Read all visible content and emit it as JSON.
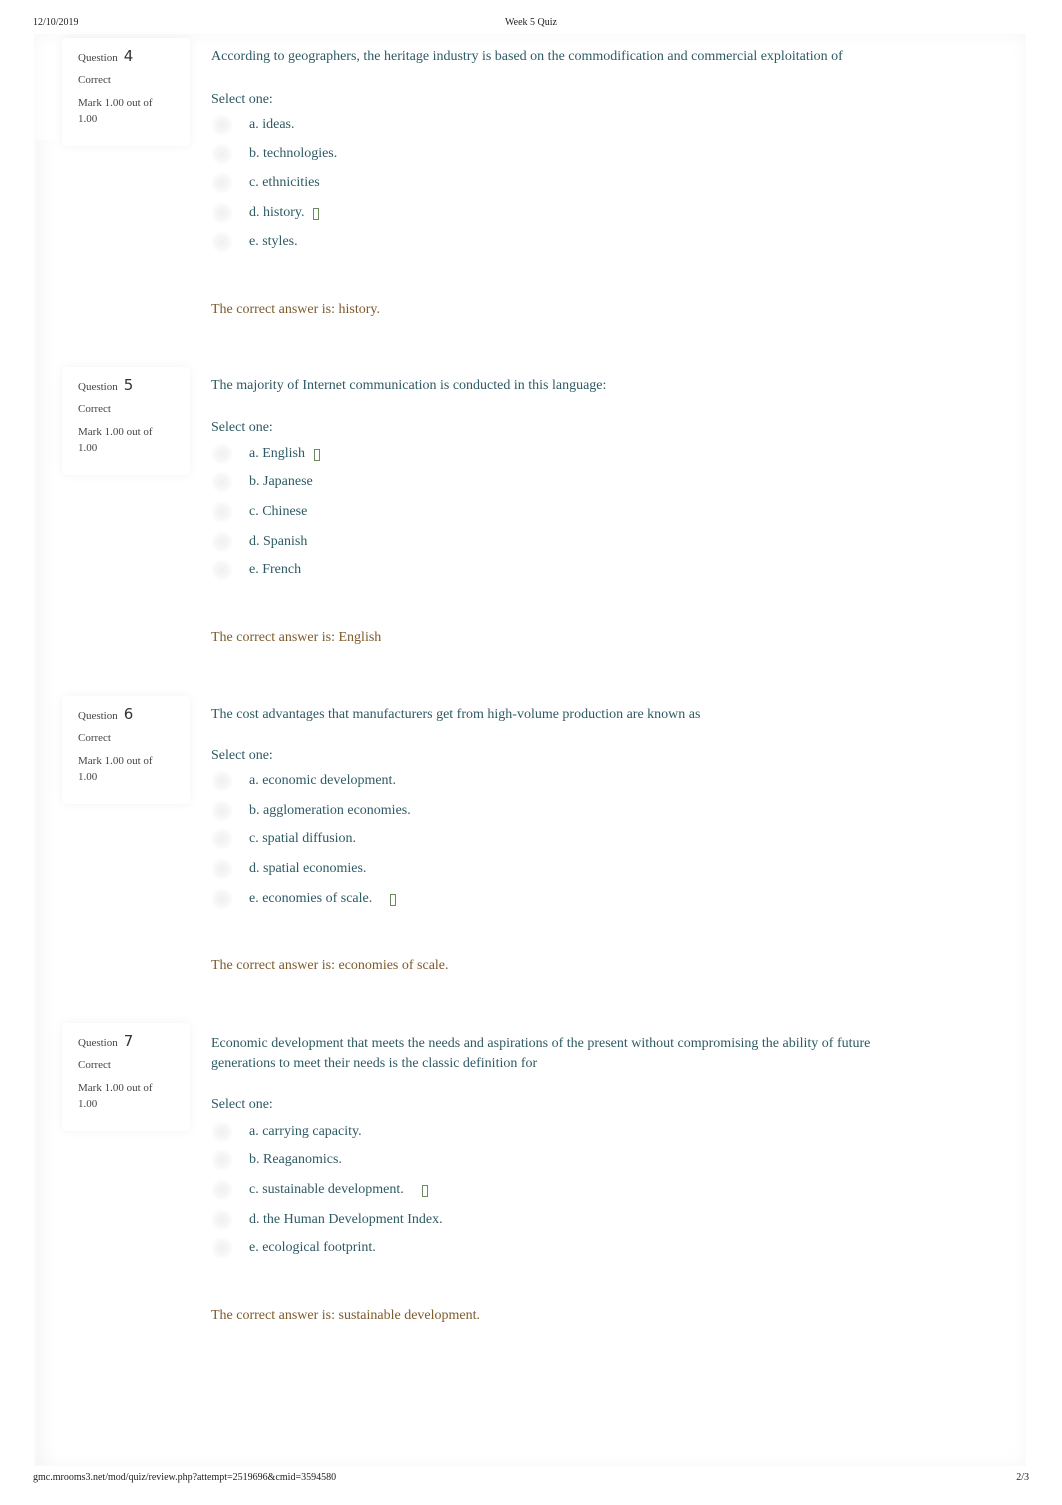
{
  "header": {
    "date": "12/10/2019",
    "title": "Week 5 Quiz"
  },
  "footer": {
    "url": "gmc.mrooms3.net/mod/quiz/review.php?attempt=2519696&cmid=3594580",
    "page": "2/3"
  },
  "labels": {
    "question": "Question",
    "select_one": "Select one:"
  },
  "colors": {
    "question_text": "#2e5a64",
    "feedback_text": "#7d5a2c",
    "check_icon": "#6c8a5e"
  },
  "questions": [
    {
      "number": "4",
      "state": "Correct",
      "grade": "Mark 1.00 out of 1.00",
      "text": "According to geographers, the heritage industry is based on the commodification and commercial exploitation of",
      "options": [
        "a. ideas.",
        "b. technologies.",
        "c. ethnicities",
        "d. history.",
        "e. styles."
      ],
      "correct_index": 3,
      "feedback": "The correct answer is: history."
    },
    {
      "number": "5",
      "state": "Correct",
      "grade": "Mark 1.00 out of 1.00",
      "text": "The majority of Internet communication is conducted in this language:",
      "options": [
        "a. English",
        "b. Japanese",
        "c. Chinese",
        "d. Spanish",
        "e. French"
      ],
      "correct_index": 0,
      "feedback": "The correct answer is: English"
    },
    {
      "number": "6",
      "state": "Correct",
      "grade": "Mark 1.00 out of 1.00",
      "text": "The cost advantages that manufacturers get from high-volume production are known as",
      "options": [
        "a. economic development.",
        "b. agglomeration economies.",
        "c. spatial diffusion.",
        "d. spatial economies.",
        "e. economies of scale."
      ],
      "correct_index": 4,
      "feedback": "The correct answer is: economies of scale."
    },
    {
      "number": "7",
      "state": "Correct",
      "grade": "Mark 1.00 out of 1.00",
      "text": "Economic development that meets the needs and aspirations of the present without compromising the ability of future generations to meet their needs is the classic definition for",
      "options": [
        "a. carrying capacity.",
        "b. Reaganomics.",
        "c. sustainable development.",
        "d. the Human Development Index.",
        "e. ecological footprint."
      ],
      "correct_index": 2,
      "feedback": "The correct answer is: sustainable development."
    }
  ]
}
